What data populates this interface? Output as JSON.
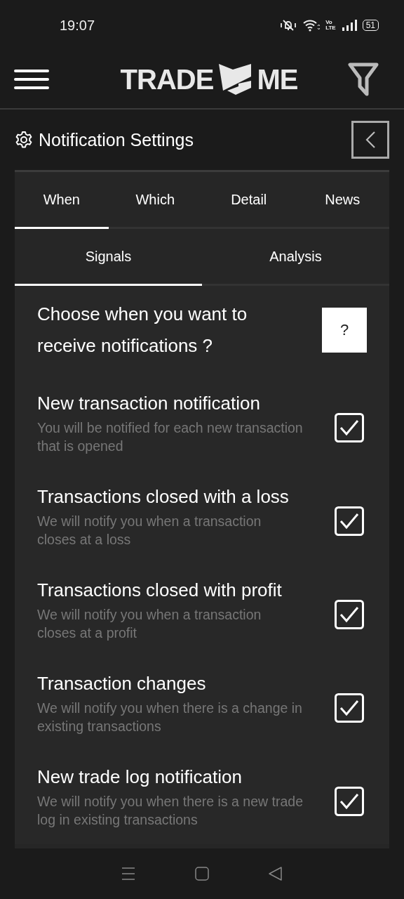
{
  "status_bar": {
    "time": "19:07",
    "network_type": [
      "Vo",
      "LTE"
    ],
    "battery": "51"
  },
  "header": {
    "logo_left": "TRADE",
    "logo_right": "ME"
  },
  "page": {
    "title": "Notification Settings"
  },
  "tabs": [
    {
      "label": "When",
      "selected": true
    },
    {
      "label": "Which",
      "selected": false
    },
    {
      "label": "Detail",
      "selected": false
    },
    {
      "label": "News",
      "selected": false
    }
  ],
  "subtabs": [
    {
      "label": "Signals",
      "selected": true
    },
    {
      "label": "Analysis",
      "selected": false
    }
  ],
  "question": {
    "text": "Choose when you want to receive notifications ?",
    "help": "?"
  },
  "options": [
    {
      "title": "New transaction notification",
      "description": "You will be notified for each new transaction that is opened",
      "checked": true
    },
    {
      "title": "Transactions closed with a loss",
      "description": "We will notify you when a transaction closes at a loss",
      "checked": true
    },
    {
      "title": "Transactions closed with profit",
      "description": "We will notify you when a transaction closes at a profit",
      "checked": true
    },
    {
      "title": "Transaction changes",
      "description": "We will notify you when there is a change in existing transactions",
      "checked": true
    },
    {
      "title": "New trade log notification",
      "description": "We will notify you when there is a new trade log in existing transactions",
      "checked": true
    }
  ]
}
